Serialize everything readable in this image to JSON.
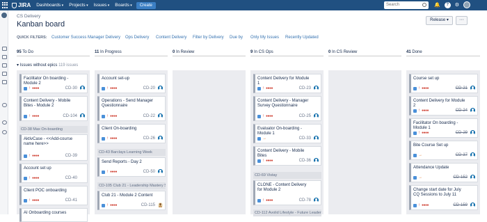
{
  "topbar": {
    "logo": "JIRA",
    "nav": [
      "Dashboards",
      "Projects",
      "Issues",
      "Boards"
    ],
    "create": "Create",
    "search_placeholder": "Search",
    "help": "?"
  },
  "breadcrumb": "CS Delivery",
  "title": "Kanban board",
  "release_button": "Release ▾",
  "more_button": "···",
  "quick_filters_label": "QUICK FILTERS:",
  "quick_filters": [
    "Customer Success Manager Delivery",
    "Ops Delivery",
    "Content Delivery",
    "Filter by Delivery",
    "Due by",
    "Only My Issues",
    "Recently Updated"
  ],
  "columns": [
    {
      "count": "95",
      "name": "To Do"
    },
    {
      "count": "11",
      "name": "In Progress"
    },
    {
      "count": "0",
      "name": "In Review"
    },
    {
      "count": "9",
      "name": "In CS Ops"
    },
    {
      "count": "0",
      "name": "In CS Review"
    },
    {
      "count": "41",
      "name": "Done"
    }
  ],
  "swimlane": {
    "label": "Issues without epics",
    "count": "119 issues",
    "chevron": "▾"
  },
  "epics": {
    "todo_1": "CD-38 Max On-boarding",
    "inprog_1": "CD-43 Barclays Learning Week",
    "inprog_2": "CD-105 Club 21 - Leadership Mastery S...",
    "cs_1": "CD-69 Vistay",
    "cs_2": "CD-112 Avolid Lifestyle - Future Leader..."
  },
  "cards": {
    "todo": [
      {
        "summary": "Facilitator On boarding - Module 2",
        "key": "CD-30",
        "priority": "↑"
      },
      {
        "summary": "Content Delivery - Mobile Bites - Module 2",
        "key": "CD-104",
        "priority": "↑"
      },
      {
        "summary": "AktivCase - <<Add-course name here>>",
        "key": "CD-39",
        "priority": "↑"
      },
      {
        "summary": "Account set up",
        "key": "CD-40",
        "priority": "↑"
      },
      {
        "summary": "Client POC onboarding",
        "key": "CD-41",
        "priority": "↑"
      },
      {
        "summary": "AI Onboarding courses",
        "key": "",
        "priority": ""
      }
    ],
    "inprog": [
      {
        "summary": "Account set-up",
        "key": "CD-20",
        "priority": "↑"
      },
      {
        "summary": "Operations - Send Manager Questionnaire",
        "key": "CD-22",
        "priority": "↑"
      },
      {
        "summary": "Client On-boarding",
        "key": "CD-26",
        "priority": "↑"
      },
      {
        "summary": "Send Reports - Day 2",
        "key": "CD-50",
        "priority": "↑"
      },
      {
        "summary": "Club 21 - Module 2 Content",
        "key": "CD-115",
        "priority": "↑"
      }
    ],
    "cs": [
      {
        "summary": "Content Delivery for Module 1",
        "key": "CD-23",
        "priority": "↑"
      },
      {
        "summary": "Content Delivery - Manager Survey Questionnaire",
        "key": "CD-25",
        "priority": "↑"
      },
      {
        "summary": "Evaluator On-boarding - Module 1",
        "key": "CD-33",
        "priority": "→"
      },
      {
        "summary": "Content Delivery - Mobile Bites",
        "key": "CD-36",
        "priority": "↑"
      },
      {
        "summary": "CLONE - Content Delivery for Module 2",
        "key": "CD-78",
        "priority": "↑"
      }
    ],
    "done": [
      {
        "summary": "Course set up",
        "key": "CD-21",
        "priority": "↑"
      },
      {
        "summary": "Content Delivery for Module 2",
        "key": "CD-24",
        "priority": "↑"
      },
      {
        "summary": "Facilitator On boarding - Module 1",
        "key": "CD-29",
        "priority": "↑"
      },
      {
        "summary": "Bite Course Set up",
        "key": "CD-37",
        "priority": "→"
      },
      {
        "summary": "Attendance Update",
        "key": "CD-152",
        "priority": "→"
      },
      {
        "summary": "Change start date for July CQ Sessions to July 11",
        "key": "CD-159",
        "priority": "↑"
      }
    ]
  },
  "colors": {
    "topbar": "#205081",
    "link": "#3572b0",
    "priority_high": "#d04437",
    "priority_medium": "#e07b35"
  }
}
